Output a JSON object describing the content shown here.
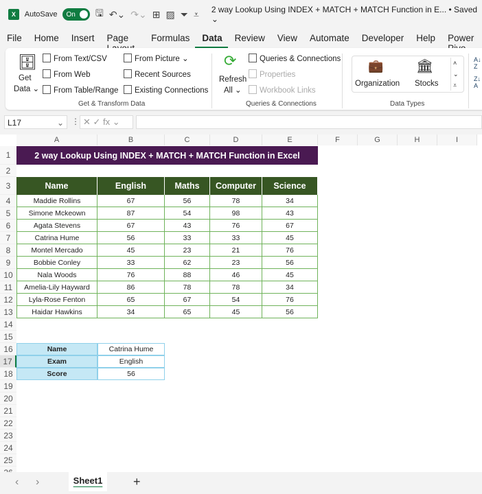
{
  "titlebar": {
    "autosave": "AutoSave",
    "toggle": "On",
    "doc_title": "2 way Lookup Using INDEX + MATCH + MATCH Function in E... • Saved ⌄"
  },
  "menu": [
    "File",
    "Home",
    "Insert",
    "Page Layout",
    "Formulas",
    "Data",
    "Review",
    "View",
    "Automate",
    "Developer",
    "Help",
    "Power Pivo"
  ],
  "ribbon": {
    "get_data": "Get",
    "get_data2": "Data ⌄",
    "from_text": "From Text/CSV",
    "from_web": "From Web",
    "from_table": "From Table/Range",
    "from_picture": "From Picture ⌄",
    "recent": "Recent Sources",
    "existing": "Existing Connections",
    "group1": "Get & Transform Data",
    "refresh": "Refresh",
    "refresh2": "All ⌄",
    "queries": "Queries & Connections",
    "properties": "Properties",
    "workbook_links": "Workbook Links",
    "group2": "Queries & Connections",
    "organization": "Organization",
    "stocks": "Stocks",
    "group3": "Data Types"
  },
  "formula_bar": {
    "name_box": "L17",
    "fx": "✕ ✓ fx ⌄",
    "formula": ""
  },
  "columns": [
    "A",
    "B",
    "C",
    "D",
    "E",
    "F",
    "G",
    "H",
    "I"
  ],
  "sheet_title": "2 way Lookup Using INDEX + MATCH + MATCH Function in Excel",
  "table": {
    "headers": [
      "Name",
      "English",
      "Maths",
      "Computer",
      "Science"
    ],
    "rows": [
      [
        "Maddie Rollins",
        "67",
        "56",
        "78",
        "34"
      ],
      [
        "Simone Mckeown",
        "87",
        "54",
        "98",
        "43"
      ],
      [
        "Agata Stevens",
        "67",
        "43",
        "76",
        "67"
      ],
      [
        "Catrina Hume",
        "56",
        "33",
        "33",
        "45"
      ],
      [
        "Montel Mercado",
        "45",
        "23",
        "21",
        "76"
      ],
      [
        "Bobbie Conley",
        "33",
        "62",
        "23",
        "56"
      ],
      [
        "Nala Woods",
        "76",
        "88",
        "46",
        "45"
      ],
      [
        "Amelia-Lily Hayward",
        "86",
        "78",
        "78",
        "34"
      ],
      [
        "Lyla-Rose Fenton",
        "65",
        "67",
        "54",
        "76"
      ],
      [
        "Haidar Hawkins",
        "34",
        "65",
        "45",
        "56"
      ]
    ]
  },
  "lookup": [
    {
      "label": "Name",
      "value": "Catrina Hume"
    },
    {
      "label": "Exam",
      "value": "English"
    },
    {
      "label": "Score",
      "value": "56"
    }
  ],
  "tabs": {
    "sheet": "Sheet1",
    "add": "+",
    "prev": "‹",
    "next": "›"
  },
  "colors": {
    "header": "#375623",
    "title": "#4a1a52",
    "lookup_label": "#c5e8f5",
    "accent": "#107c41"
  }
}
